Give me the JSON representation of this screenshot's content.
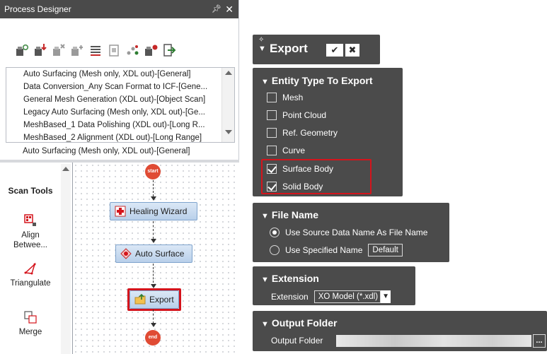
{
  "panel": {
    "title": "Process Designer",
    "pin_glyph": "⎈",
    "close_glyph": "✕"
  },
  "toolbar": {
    "icons": [
      "add-process-icon",
      "import-process-icon",
      "delete-process-icon",
      "duplicate-process-icon",
      "list-edit-icon",
      "properties-icon",
      "share-icon",
      "run-process-icon",
      "exit-icon"
    ]
  },
  "process_list": {
    "items": [
      "Auto Surfacing (Mesh only, XDL out)-[General]",
      "Data Conversion_Any Scan Format to ICF-[Gene...",
      "General Mesh Generation (XDL out)-[Object Scan]",
      "Legacy Auto Surfacing (Mesh only, XDL out)-[Ge...",
      "MeshBased_1 Data Polishing (XDL out)-[Long R...",
      "MeshBased_2 Alignment (XDL out)-[Long Range]"
    ],
    "selected": "Auto Surfacing (Mesh only, XDL out)-[General]"
  },
  "scan_tools": {
    "heading": "Scan Tools",
    "tools": [
      "Align\nBetwee...",
      "Triangulate",
      "Merge"
    ]
  },
  "flow": {
    "start_label": "start",
    "end_label": "end",
    "nodes": [
      "Healing Wizard",
      "Auto Surface",
      "Export"
    ]
  },
  "export": {
    "title": "Export",
    "confirm_glyph": "✔",
    "cancel_glyph": "✖",
    "entity_type": {
      "title": "Entity Type To Export",
      "options": [
        {
          "label": "Mesh",
          "checked": false
        },
        {
          "label": "Point Cloud",
          "checked": false
        },
        {
          "label": "Ref. Geometry",
          "checked": false
        },
        {
          "label": "Curve",
          "checked": false
        },
        {
          "label": "Surface Body",
          "checked": true
        },
        {
          "label": "Solid Body",
          "checked": true
        }
      ]
    },
    "file_name": {
      "title": "File Name",
      "option_source": "Use Source Data Name As File Name",
      "option_specified": "Use Specified Name",
      "specified_value": "Default",
      "selected": "source"
    },
    "extension": {
      "title": "Extension",
      "label": "Extension",
      "value": "XO Model (*.xdl)"
    },
    "output_folder": {
      "title": "Output Folder",
      "label": "Output Folder",
      "browse_label": "..."
    }
  },
  "colors": {
    "panel_dark": "#4b4b4b",
    "highlight_red": "#d4141c",
    "node_blue": "#b9d0ea",
    "title_bar": "#4a4a4a"
  }
}
